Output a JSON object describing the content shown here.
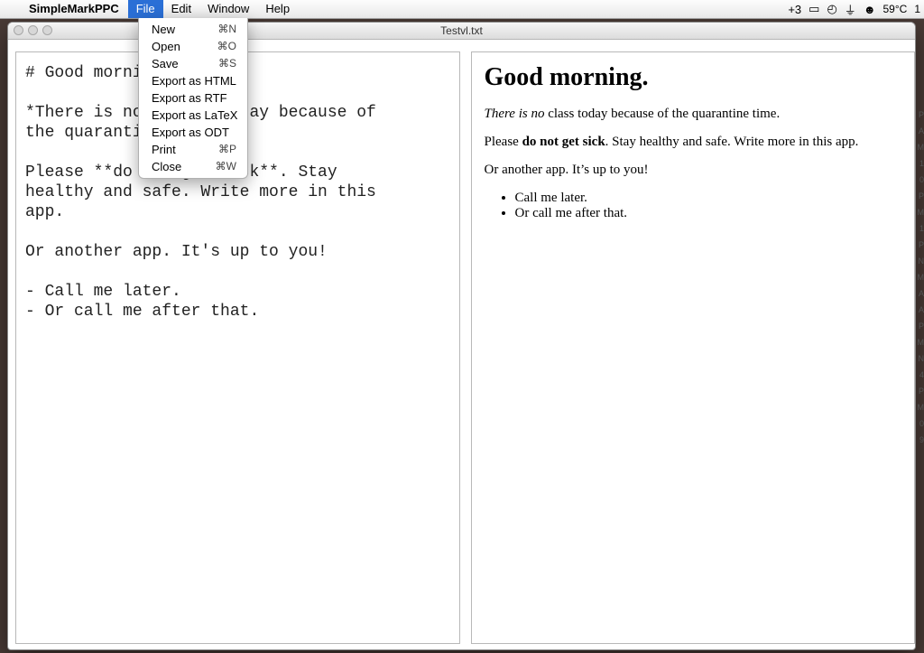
{
  "menubar": {
    "app_name": "SimpleMarkPPC",
    "items": [
      "File",
      "Edit",
      "Window",
      "Help"
    ],
    "open_index": 0,
    "status": {
      "badge": "+3",
      "temp": "59°C",
      "extra": "1"
    }
  },
  "file_menu": [
    {
      "label": "New",
      "shortcut": "⌘N"
    },
    {
      "label": "Open",
      "shortcut": "⌘O"
    },
    {
      "label": "Save",
      "shortcut": "⌘S"
    },
    {
      "label": "Export as HTML",
      "shortcut": ""
    },
    {
      "label": "Export as RTF",
      "shortcut": ""
    },
    {
      "label": "Export as LaTeX",
      "shortcut": ""
    },
    {
      "label": "Export as ODT",
      "shortcut": ""
    },
    {
      "label": "Print",
      "shortcut": "⌘P"
    },
    {
      "label": "Close",
      "shortcut": "⌘W"
    }
  ],
  "window": {
    "title": "Testvl.txt"
  },
  "editor": {
    "raw": "# Good morning.\n\n*There is no* class today because of\nthe quarantine time.\n\nPlease **do not get sick**. Stay\nhealthy and safe. Write more in this\napp.\n\nOr another app. It's up to you!\n\n- Call me later.\n- Or call me after that."
  },
  "preview": {
    "heading": "Good morning.",
    "p1_em": "There is no",
    "p1_rest": " class today because of the quarantine time.",
    "p2_a": "Please ",
    "p2_strong": "do not get sick",
    "p2_b": ". Stay healthy and safe. Write more in this app.",
    "p3": "Or another app. It’s up to you!",
    "li1": "Call me later.",
    "li2": "Or call me after that."
  },
  "edge_strip": [
    "P",
    "A",
    "M",
    "1",
    "0",
    "P",
    "M",
    "1",
    " ",
    "P",
    "N",
    "M",
    "A",
    "A",
    "P",
    "M",
    "N",
    "4",
    "P",
    "M",
    "0",
    "9"
  ]
}
